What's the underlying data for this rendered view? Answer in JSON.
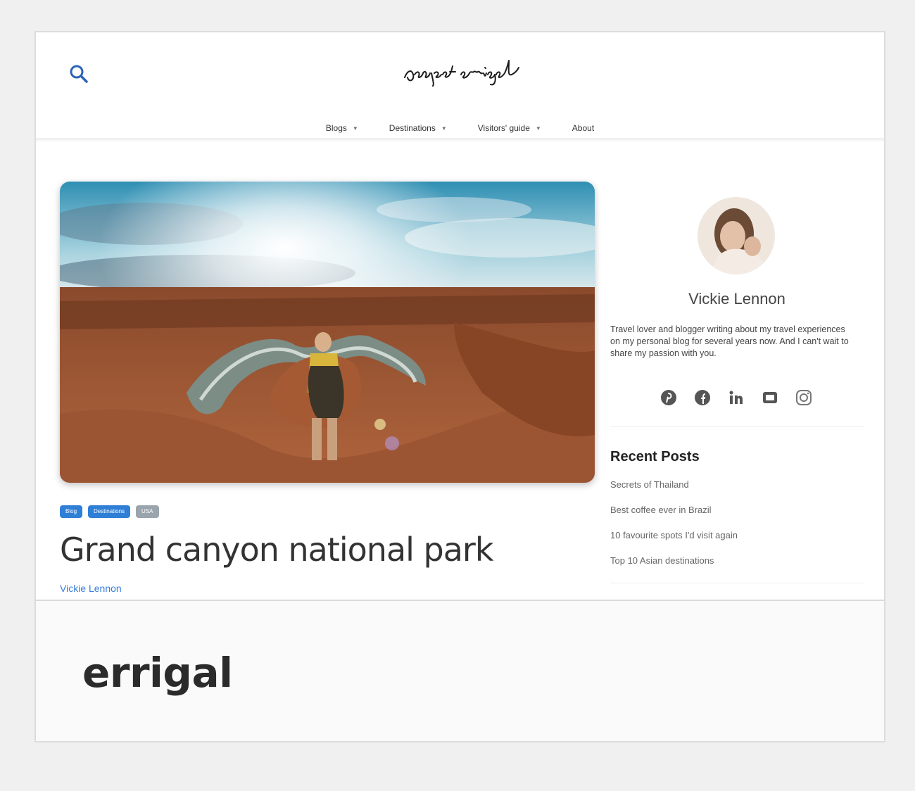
{
  "site": {
    "logo_text": "project errigal"
  },
  "nav": {
    "items": [
      {
        "label": "Blogs"
      },
      {
        "label": "Destinations"
      },
      {
        "label": "Visitors' guide"
      },
      {
        "label": "About"
      }
    ]
  },
  "post": {
    "tags": [
      {
        "label": "Blog",
        "color": "#2f7fd6"
      },
      {
        "label": "Destinations",
        "color": "#2f7fd6"
      },
      {
        "label": "USA",
        "color": "#9aa4ad"
      }
    ],
    "title": "Grand canyon national park",
    "author": "Vickie Lennon"
  },
  "sidebar": {
    "author_name": "Vickie Lennon",
    "author_bio": "Travel lover and blogger writing about my travel experiences on my personal blog for several years now. And I can't wait to share my passion with you.",
    "socials": [
      "pinterest-icon",
      "facebook-icon",
      "linkedin-icon",
      "youtube-icon",
      "instagram-icon"
    ],
    "recent_heading": "Recent Posts",
    "recent_posts": [
      {
        "label": "Secrets of Thailand"
      },
      {
        "label": "Best coffee ever in Brazil"
      },
      {
        "label": "10 favourite spots I'd visit again"
      },
      {
        "label": "Top 10 Asian destinations"
      }
    ]
  },
  "footer": {
    "title": "errigal"
  },
  "colors": {
    "accent": "#2f7fd6",
    "search_icon": "#2a64b5"
  }
}
